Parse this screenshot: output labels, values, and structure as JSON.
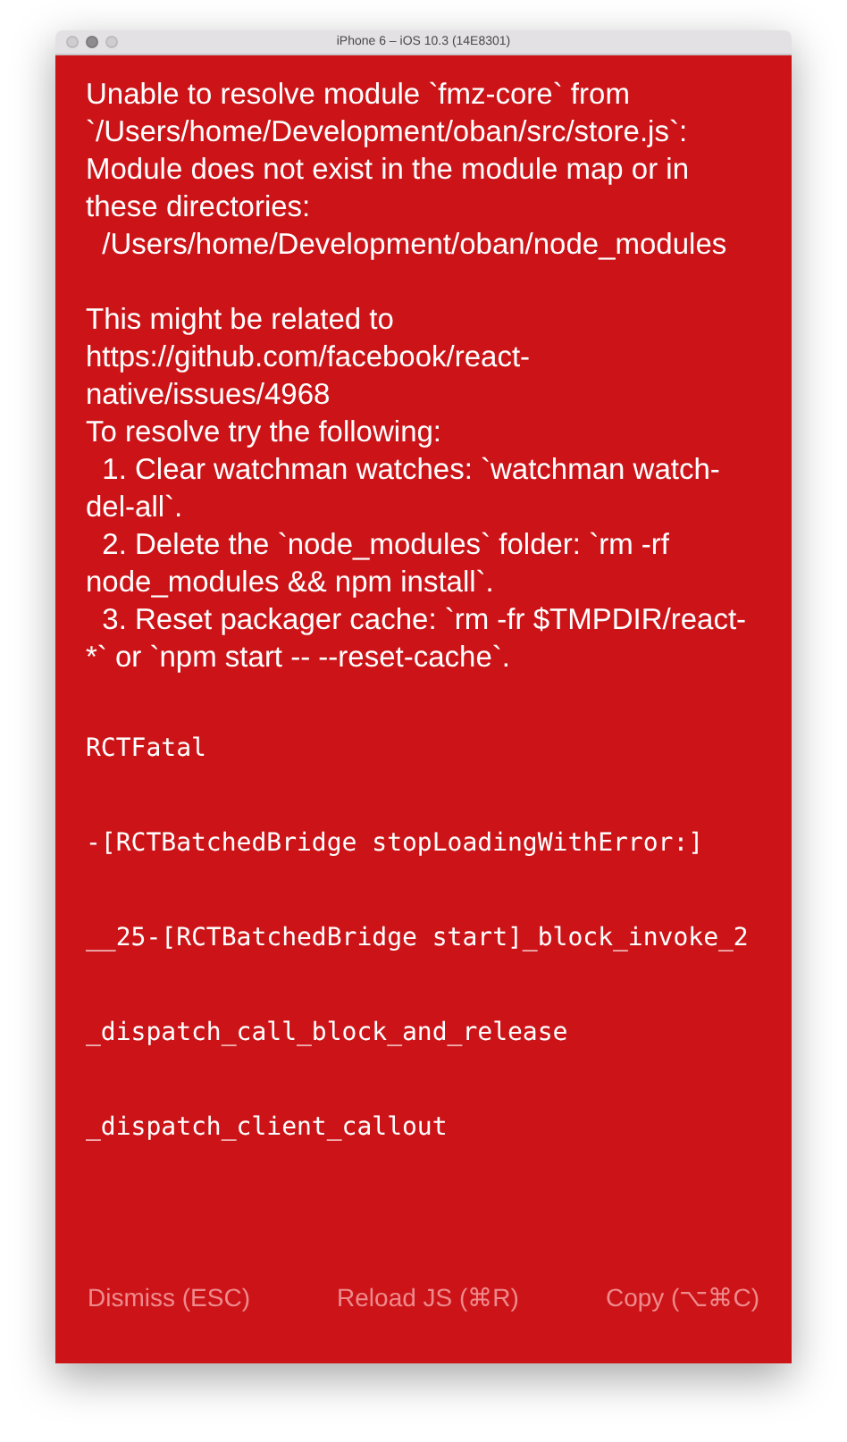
{
  "window": {
    "title": "iPhone 6 – iOS 10.3 (14E8301)"
  },
  "error": {
    "message": "Unable to resolve module `fmz-core` from `/Users/home/Development/oban/src/store.js`: Module does not exist in the module map or in these directories:\n  /Users/home/Development/oban/node_modules\n\nThis might be related to https://github.com/facebook/react-native/issues/4968\nTo resolve try the following:\n  1. Clear watchman watches: `watchman watch-del-all`.\n  2. Delete the `node_modules` folder: `rm -rf node_modules && npm install`.\n  3. Reset packager cache: `rm -fr $TMPDIR/react-*` or `npm start -- --reset-cache`."
  },
  "stack": [
    "RCTFatal",
    "-[RCTBatchedBridge stopLoadingWithError:]",
    "__25-[RCTBatchedBridge start]_block_invoke_2",
    "_dispatch_call_block_and_release",
    "_dispatch_client_callout"
  ],
  "buttons": [
    "Dismiss (ESC)",
    "Reload JS (⌘R)",
    "Copy (⌥⌘C)"
  ]
}
